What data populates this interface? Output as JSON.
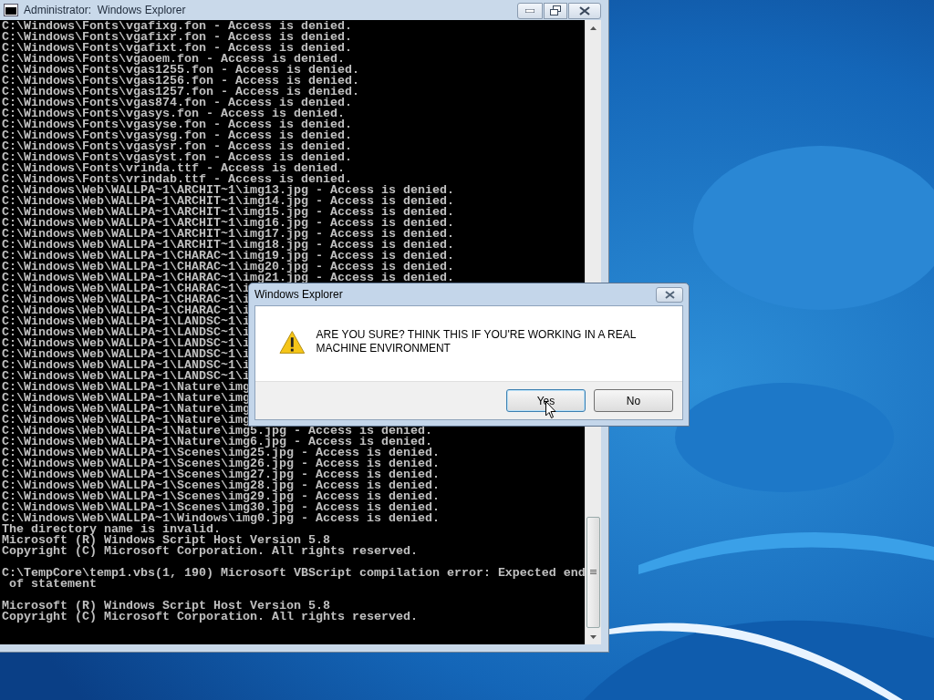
{
  "console_window": {
    "title": "Administrator:  Windows Explorer",
    "blocks": [
      [
        "C:\\Windows\\Fonts\\vgafixg.fon - Access is denied.",
        "C:\\Windows\\Fonts\\vgafixr.fon - Access is denied.",
        "C:\\Windows\\Fonts\\vgafixt.fon - Access is denied.",
        "C:\\Windows\\Fonts\\vgaoem.fon - Access is denied.",
        "C:\\Windows\\Fonts\\vgas1255.fon - Access is denied.",
        "C:\\Windows\\Fonts\\vgas1256.fon - Access is denied.",
        "C:\\Windows\\Fonts\\vgas1257.fon - Access is denied.",
        "C:\\Windows\\Fonts\\vgas874.fon - Access is denied.",
        "C:\\Windows\\Fonts\\vgasys.fon - Access is denied.",
        "C:\\Windows\\Fonts\\vgasyse.fon - Access is denied.",
        "C:\\Windows\\Fonts\\vgasysg.fon - Access is denied.",
        "C:\\Windows\\Fonts\\vgasysr.fon - Access is denied.",
        "C:\\Windows\\Fonts\\vgasyst.fon - Access is denied.",
        "C:\\Windows\\Fonts\\vrinda.ttf - Access is denied.",
        "C:\\Windows\\Fonts\\vrindab.ttf - Access is denied.",
        "C:\\Windows\\Web\\WALLPA~1\\ARCHIT~1\\img13.jpg - Access is denied.",
        "C:\\Windows\\Web\\WALLPA~1\\ARCHIT~1\\img14.jpg - Access is denied.",
        "C:\\Windows\\Web\\WALLPA~1\\ARCHIT~1\\img15.jpg - Access is denied.",
        "C:\\Windows\\Web\\WALLPA~1\\ARCHIT~1\\img16.jpg - Access is denied.",
        "C:\\Windows\\Web\\WALLPA~1\\ARCHIT~1\\img17.jpg - Access is denied.",
        "C:\\Windows\\Web\\WALLPA~1\\ARCHIT~1\\img18.jpg - Access is denied.",
        "C:\\Windows\\Web\\WALLPA~1\\CHARAC~1\\img19.jpg - Access is denied.",
        "C:\\Windows\\Web\\WALLPA~1\\CHARAC~1\\img20.jpg - Access is denied.",
        "C:\\Windows\\Web\\WALLPA~1\\CHARAC~1\\img21.jpg - Access is denied.",
        "C:\\Windows\\Web\\WALLPA~1\\CHARAC~1\\i",
        "C:\\Windows\\Web\\WALLPA~1\\CHARAC~1\\i",
        "C:\\Windows\\Web\\WALLPA~1\\CHARAC~1\\i",
        "C:\\Windows\\Web\\WALLPA~1\\LANDSC~1\\i",
        "C:\\Windows\\Web\\WALLPA~1\\LANDSC~1\\i",
        "C:\\Windows\\Web\\WALLPA~1\\LANDSC~1\\i",
        "C:\\Windows\\Web\\WALLPA~1\\LANDSC~1\\i",
        "C:\\Windows\\Web\\WALLPA~1\\LANDSC~1\\i",
        "C:\\Windows\\Web\\WALLPA~1\\LANDSC~1\\i",
        "C:\\Windows\\Web\\WALLPA~1\\Nature\\img",
        "C:\\Windows\\Web\\WALLPA~1\\Nature\\img",
        "C:\\Windows\\Web\\WALLPA~1\\Nature\\img",
        "C:\\Windows\\Web\\WALLPA~1\\Nature\\img",
        "C:\\Windows\\Web\\WALLPA~1\\Nature\\img5.jpg - Access is denied.",
        "C:\\Windows\\Web\\WALLPA~1\\Nature\\img6.jpg - Access is denied.",
        "C:\\Windows\\Web\\WALLPA~1\\Scenes\\img25.jpg - Access is denied.",
        "C:\\Windows\\Web\\WALLPA~1\\Scenes\\img26.jpg - Access is denied.",
        "C:\\Windows\\Web\\WALLPA~1\\Scenes\\img27.jpg - Access is denied.",
        "C:\\Windows\\Web\\WALLPA~1\\Scenes\\img28.jpg - Access is denied.",
        "C:\\Windows\\Web\\WALLPA~1\\Scenes\\img29.jpg - Access is denied.",
        "C:\\Windows\\Web\\WALLPA~1\\Scenes\\img30.jpg - Access is denied.",
        "C:\\Windows\\Web\\WALLPA~1\\Windows\\img0.jpg - Access is denied.",
        "The directory name is invalid.",
        "Microsoft (R) Windows Script Host Version 5.8",
        "Copyright (C) Microsoft Corporation. All rights reserved."
      ],
      [
        "C:\\TempCore\\temp1.vbs(1, 190) Microsoft VBScript compilation error: Expected end",
        " of statement"
      ],
      [
        "Microsoft (R) Windows Script Host Version 5.8",
        "Copyright (C) Microsoft Corporation. All rights reserved."
      ]
    ]
  },
  "dialog": {
    "title": "Windows Explorer",
    "message": "ARE YOU SURE? THINK THIS IF YOU'RE WORKING IN A REAL MACHINE ENVIRONMENT",
    "buttons": [
      {
        "label": "Yes",
        "focused": true
      },
      {
        "label": "No",
        "focused": false
      }
    ]
  }
}
